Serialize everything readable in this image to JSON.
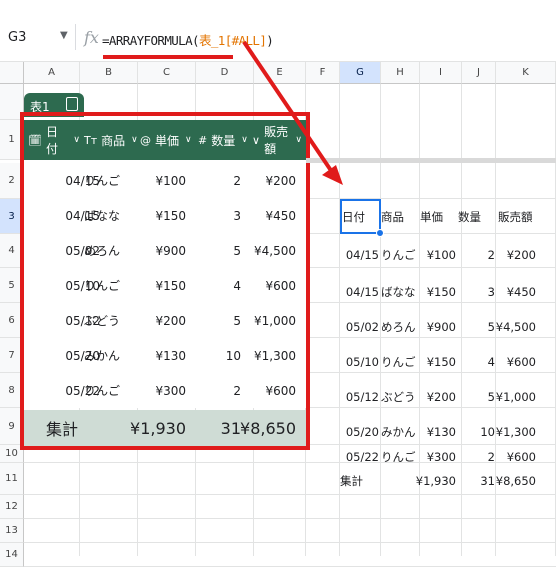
{
  "formula_bar": {
    "name_box": "G3",
    "fx_label": "fx",
    "formula_prefix": "=ARRAYFORMULA(",
    "formula_ref": "表_1[#ALL]",
    "formula_suffix": ")"
  },
  "columns": [
    "A",
    "B",
    "C",
    "D",
    "E",
    "F",
    "G",
    "H",
    "I",
    "J",
    "K"
  ],
  "rows": [
    "1",
    "2",
    "3",
    "4",
    "5",
    "6",
    "7",
    "8",
    "9",
    "10",
    "11",
    "12",
    "13",
    "14"
  ],
  "table": {
    "tab_name": "表1",
    "headers": [
      {
        "icon": "🗓",
        "label": "日付"
      },
      {
        "icon": "Tт",
        "label": "商品"
      },
      {
        "icon": "@",
        "label": "単価"
      },
      {
        "icon": "#",
        "label": "数量"
      },
      {
        "icon": "∨",
        "label": "販売額"
      }
    ],
    "rows": [
      [
        "04/15",
        "りんご",
        "¥100",
        "2",
        "¥200"
      ],
      [
        "04/15",
        "ばなな",
        "¥150",
        "3",
        "¥450"
      ],
      [
        "05/02",
        "めろん",
        "¥900",
        "5",
        "¥4,500"
      ],
      [
        "05/10",
        "りんご",
        "¥150",
        "4",
        "¥600"
      ],
      [
        "05/12",
        "ぶどう",
        "¥200",
        "5",
        "¥1,000"
      ],
      [
        "05/20",
        "みかん",
        "¥130",
        "10",
        "¥1,300"
      ],
      [
        "05/22",
        "りんご",
        "¥300",
        "2",
        "¥600"
      ]
    ],
    "total": {
      "label": "集計",
      "price": "¥1,930",
      "qty": "31",
      "amount": "¥8,650"
    }
  },
  "result": {
    "headers": [
      "日付",
      "商品",
      "単価",
      "数量",
      "販売額"
    ],
    "rows": [
      [
        "04/15",
        "りんご",
        "¥100",
        "2",
        "¥200"
      ],
      [
        "04/15",
        "ばなな",
        "¥150",
        "3",
        "¥450"
      ],
      [
        "05/02",
        "めろん",
        "¥900",
        "5",
        "¥4,500"
      ],
      [
        "05/10",
        "りんご",
        "¥150",
        "4",
        "¥600"
      ],
      [
        "05/12",
        "ぶどう",
        "¥200",
        "5",
        "¥1,000"
      ],
      [
        "05/20",
        "みかん",
        "¥130",
        "10",
        "¥1,300"
      ],
      [
        "05/22",
        "りんご",
        "¥300",
        "2",
        "¥600"
      ]
    ],
    "total": {
      "label": "集計",
      "price": "¥1,930",
      "qty": "31",
      "amount": "¥8,650"
    }
  },
  "colors": {
    "table_green": "#2d6a4f",
    "total_row": "#cfdcd5",
    "highlight_red": "#e01b1b",
    "selection_blue": "#1a73e8"
  }
}
